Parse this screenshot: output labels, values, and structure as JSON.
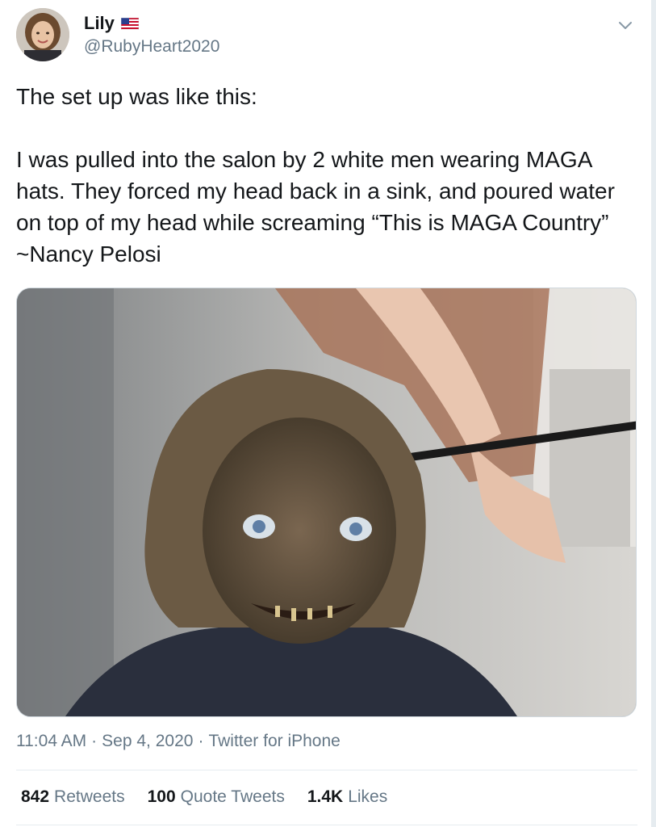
{
  "user": {
    "display_name": "Lily",
    "handle": "@RubyHeart2020",
    "flag_icon": "us-flag-icon"
  },
  "tweet": {
    "paragraphs": [
      "The set up was like this:",
      "I was pulled into the salon by 2 white men wearing MAGA hats. They forced my head back in a sink, and poured water on top of my head while screaming “This is MAGA Country” ~Nancy Pelosi"
    ]
  },
  "meta": {
    "time": "11:04 AM",
    "date": "Sep 4, 2020",
    "source": "Twitter for iPhone",
    "separator": "·"
  },
  "stats": {
    "retweets_count": "842",
    "retweets_label": "Retweets",
    "quotes_count": "100",
    "quotes_label": "Quote Tweets",
    "likes_count": "1.4K",
    "likes_label": "Likes"
  },
  "colors": {
    "text_primary": "#14171a",
    "text_secondary": "#657786",
    "divider": "#e6ecf0"
  }
}
